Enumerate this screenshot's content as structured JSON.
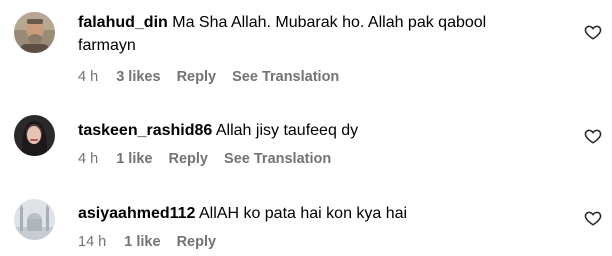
{
  "comments": [
    {
      "username": "falahud_din",
      "text_line1": "Ma Sha Allah. Mubarak ho. Allah pak qabool",
      "text_line2": "farmayn",
      "time": "4 h",
      "likes": "3 likes",
      "reply_label": "Reply",
      "translation_label": "See Translation",
      "avatar_icon": "profile-photo-man",
      "like_icon": "heart-outline-icon"
    },
    {
      "username": "taskeen_rashid86",
      "text_line1": "Allah jisy taufeeq dy",
      "time": "4 h",
      "likes": "1 like",
      "reply_label": "Reply",
      "translation_label": "See Translation",
      "avatar_icon": "profile-photo-woman",
      "like_icon": "heart-outline-icon"
    },
    {
      "username": "asiyaahmed112",
      "text_line1": "AllAH ko pata hai kon kya hai",
      "time": "14 h",
      "likes": "1 like",
      "reply_label": "Reply",
      "avatar_icon": "profile-photo-mosque",
      "like_icon": "heart-outline-icon"
    }
  ],
  "colors": {
    "text": "#000000",
    "meta": "#737373"
  }
}
